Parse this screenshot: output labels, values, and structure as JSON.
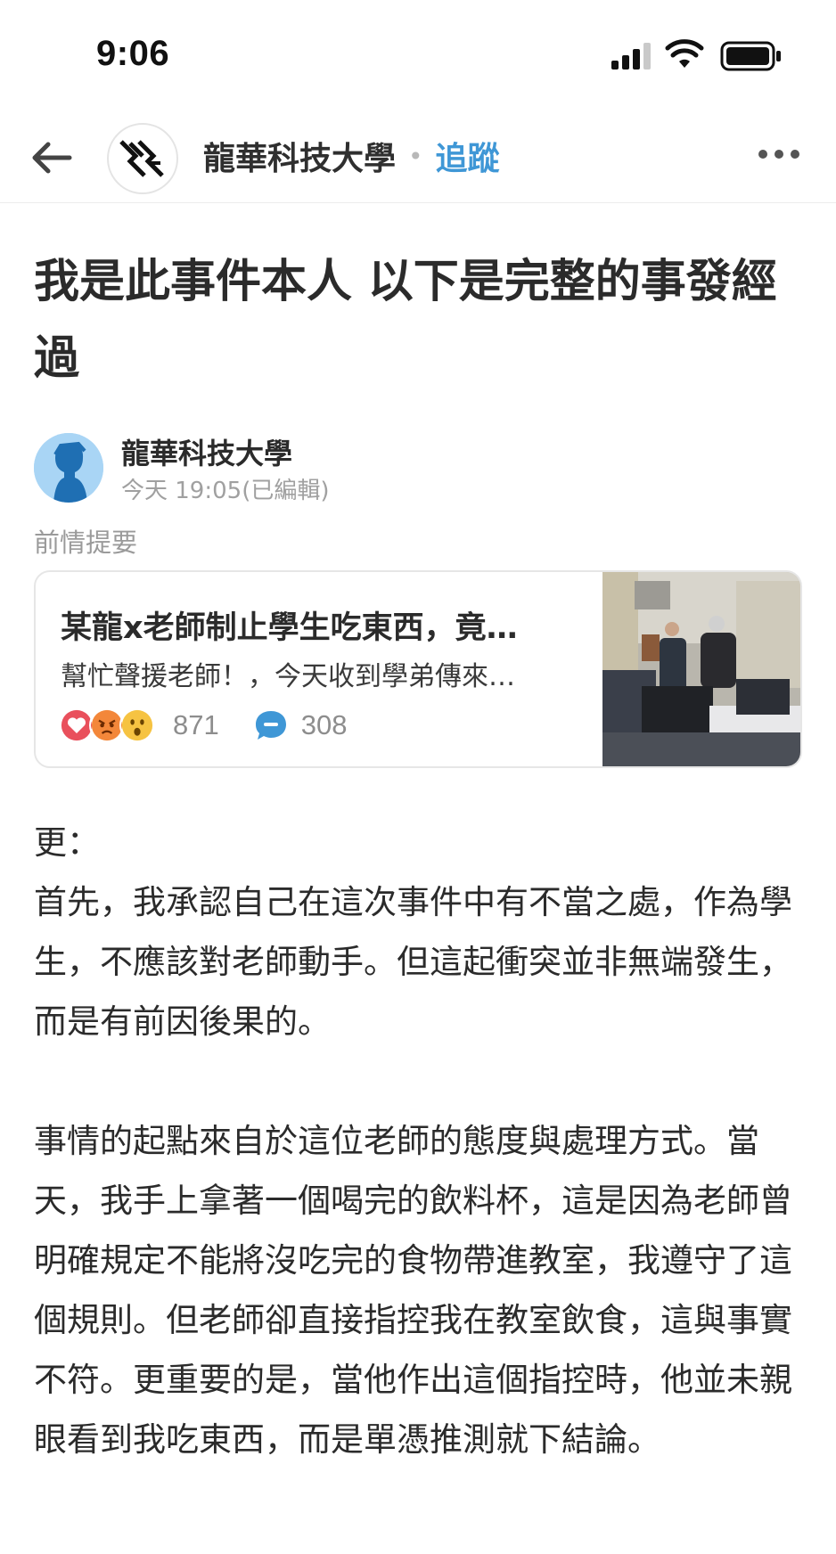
{
  "status_bar": {
    "time": "9:06",
    "icons": [
      "cellular-signal-icon",
      "wifi-icon",
      "battery-icon"
    ]
  },
  "nav": {
    "back_icon": "back-arrow-icon",
    "board_name": "龍華科技大學",
    "separator": "•",
    "follow_label": "追蹤",
    "more_icon": "more-dots-icon"
  },
  "post": {
    "title": "我是此事件本人 以下是完整的事發經過",
    "author": "龍華科技大學",
    "meta": "今天 19:05(已編輯)"
  },
  "reference": {
    "section_label": "前情提要",
    "title": "某龍x老師制止學生吃東西，竟…",
    "excerpt": "幫忙聲援老師！，今天收到學弟傳來…",
    "reaction_count": "871",
    "comment_count": "308",
    "reaction_icons": [
      "heart-reaction-icon",
      "angry-reaction-icon",
      "wow-reaction-icon"
    ],
    "thumbnail": "classroom-photo-thumbnail"
  },
  "body": {
    "p1": "更：",
    "p2": "首先，我承認自己在這次事件中有不當之處，作為學生，不應該對老師動手。但這起衝突並非無端發生，而是有前因後果的。",
    "p3": "事情的起點來自於這位老師的態度與處理方式。當天，我手上拿著一個喝完的飲料杯，這是因為老師曾明確規定不能將沒吃完的食物帶進教室，我遵守了這個規則。但老師卻直接指控我在教室飲食，這與事實不符。更重要的是，當他作出這個指控時，他並未親眼看到我吃東西，而是單憑推測就下結論。"
  },
  "colors": {
    "accent": "#3f97d6",
    "muted_text": "#a0a0a0",
    "heart": "#e9505c",
    "angry": "#f3873a",
    "wow": "#f6c342"
  }
}
